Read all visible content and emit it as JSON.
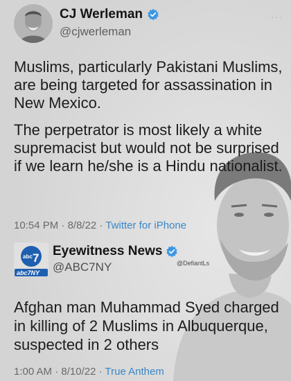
{
  "tweet": {
    "author_name": "CJ Werleman",
    "author_handle": "@cjwerleman",
    "more_label": "···",
    "text_paragraphs": [
      "Muslims, particularly Pakistani Muslims, are being targeted for assassination in New Mexico.",
      "The perpetrator is most likely a white supremacist but would not be surprised if we learn he/she is a Hindu nationalist."
    ],
    "time": "10:54 PM",
    "date": "8/8/22",
    "source": "Twitter for iPhone",
    "separator": " · "
  },
  "quoted": {
    "author_name": "Eyewitness News",
    "author_handle": "@ABC7NY",
    "logo_text": "abc7NY",
    "logo_number": "7",
    "logo_abc": "abc",
    "text": "Afghan man Muhammad Syed charged in killing of 2 Muslims in Albuquerque, suspected in 2 others",
    "time": "1:00 AM",
    "date": "8/10/22",
    "source": "True Anthem",
    "separator": " · "
  },
  "watermark": "@DefiantLs",
  "colors": {
    "verified_badge": "#3b97e3",
    "source_link": "#3a86c8",
    "logo_blue": "#1f5fb0"
  },
  "icons": {
    "verified": "verified-badge-icon",
    "more": "more-options-icon"
  }
}
